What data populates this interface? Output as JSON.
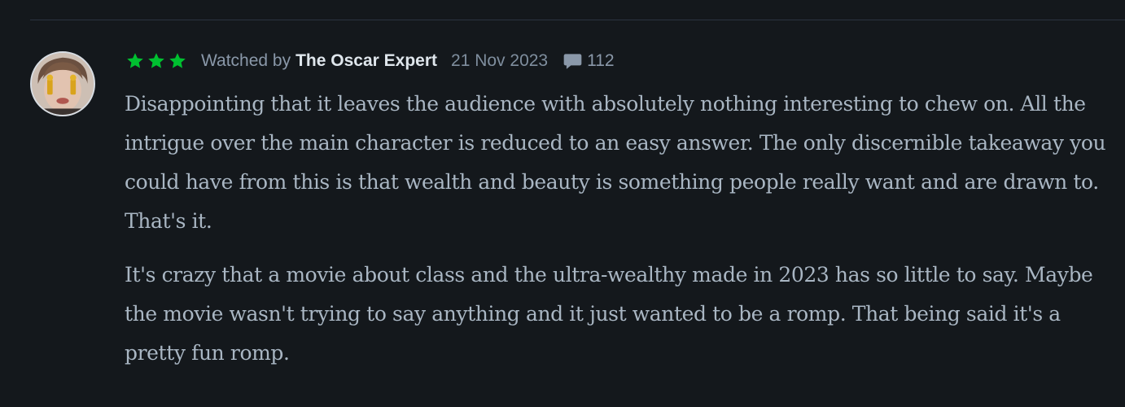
{
  "review": {
    "rating_stars": 3,
    "rating_color": "#00c030",
    "watched_prefix": "Watched by",
    "reviewer_name": "The Oscar Expert",
    "date": "21 Nov 2023",
    "comment_icon": "speech-bubble-icon",
    "comment_count": "112",
    "paragraphs": [
      "Disappointing that it leaves the audience with absolutely nothing interesting to chew on. All the intrigue over the main character is reduced to an easy answer. The only discernible takeaway you could have from this is that wealth and beauty is something people really want and are drawn to. That's it.",
      "It's crazy that a movie about class and the ultra-wealthy made in 2023 has so little to say. Maybe the movie wasn't trying to say anything and it just wanted to be a romp. That being said it's a pretty fun romp."
    ]
  },
  "colors": {
    "background": "#14181c",
    "divider": "#2c3440",
    "body_text": "#a9b6c3",
    "name_text": "#dfe6ec",
    "meta_text": "#8a98a9"
  }
}
